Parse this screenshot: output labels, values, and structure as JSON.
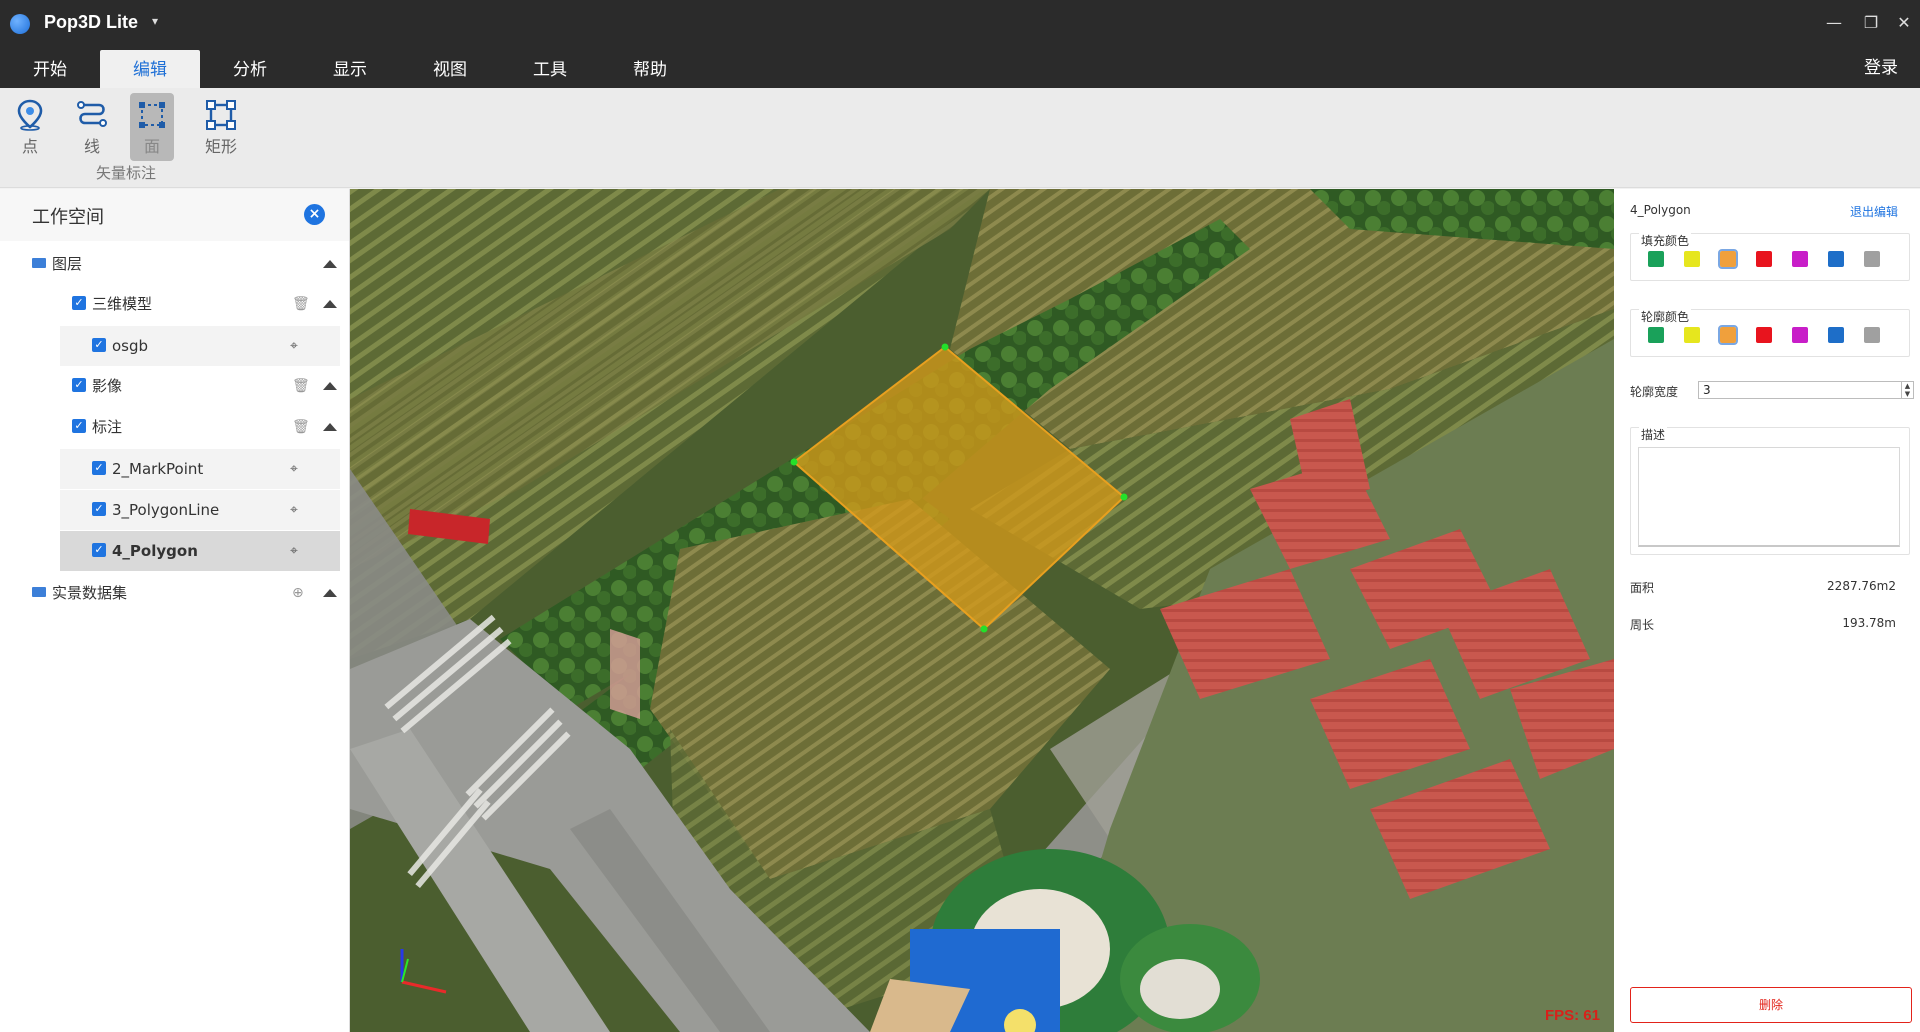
{
  "app": {
    "title": "Pop3D Lite",
    "dropdown": "▾",
    "window_controls": [
      "—",
      "❐",
      "✕"
    ]
  },
  "menu": {
    "tabs": [
      "开始",
      "编辑",
      "分析",
      "显示",
      "视图",
      "工具",
      "帮助"
    ],
    "active_index": 1,
    "login": "登录"
  },
  "toolbar": {
    "tools": [
      {
        "label": "点",
        "icon": "location-pin-icon"
      },
      {
        "label": "线",
        "icon": "polyline-icon"
      },
      {
        "label": "面",
        "icon": "polygon-icon",
        "active": true
      },
      {
        "label": "矩形",
        "icon": "rectangle-icon"
      }
    ],
    "group_label": "矢量标注"
  },
  "workspace": {
    "title": "工作空间",
    "close": "×",
    "tree": {
      "layers_label": "图层",
      "model_label": "三维模型",
      "osgb_label": "osgb",
      "imagery_label": "影像",
      "annotations_label": "标注",
      "markpoint_label": "2_MarkPoint",
      "polygonline_label": "3_PolygonLine",
      "polygon_label": "4_Polygon",
      "dataset_label": "实景数据集"
    }
  },
  "map": {
    "fps": "FPS: 61"
  },
  "properties": {
    "title": "4_Polygon",
    "exit_edit": "退出编辑",
    "fill_color_label": "填充颜色",
    "outline_color_label": "轮廓颜色",
    "palette": [
      "#1aa15a",
      "#e6e61e",
      "#f0a03c",
      "#e8141e",
      "#c81ec8",
      "#1e6ec8",
      "#a0a0a0"
    ],
    "selected_color": "#f0a03c",
    "outline_width_label": "轮廓宽度",
    "outline_width_value": "3",
    "description_label": "描述",
    "area_label": "面积",
    "area_value": "2287.76m2",
    "perimeter_label": "周长",
    "perimeter_value": "193.78m",
    "delete_label": "删除"
  }
}
